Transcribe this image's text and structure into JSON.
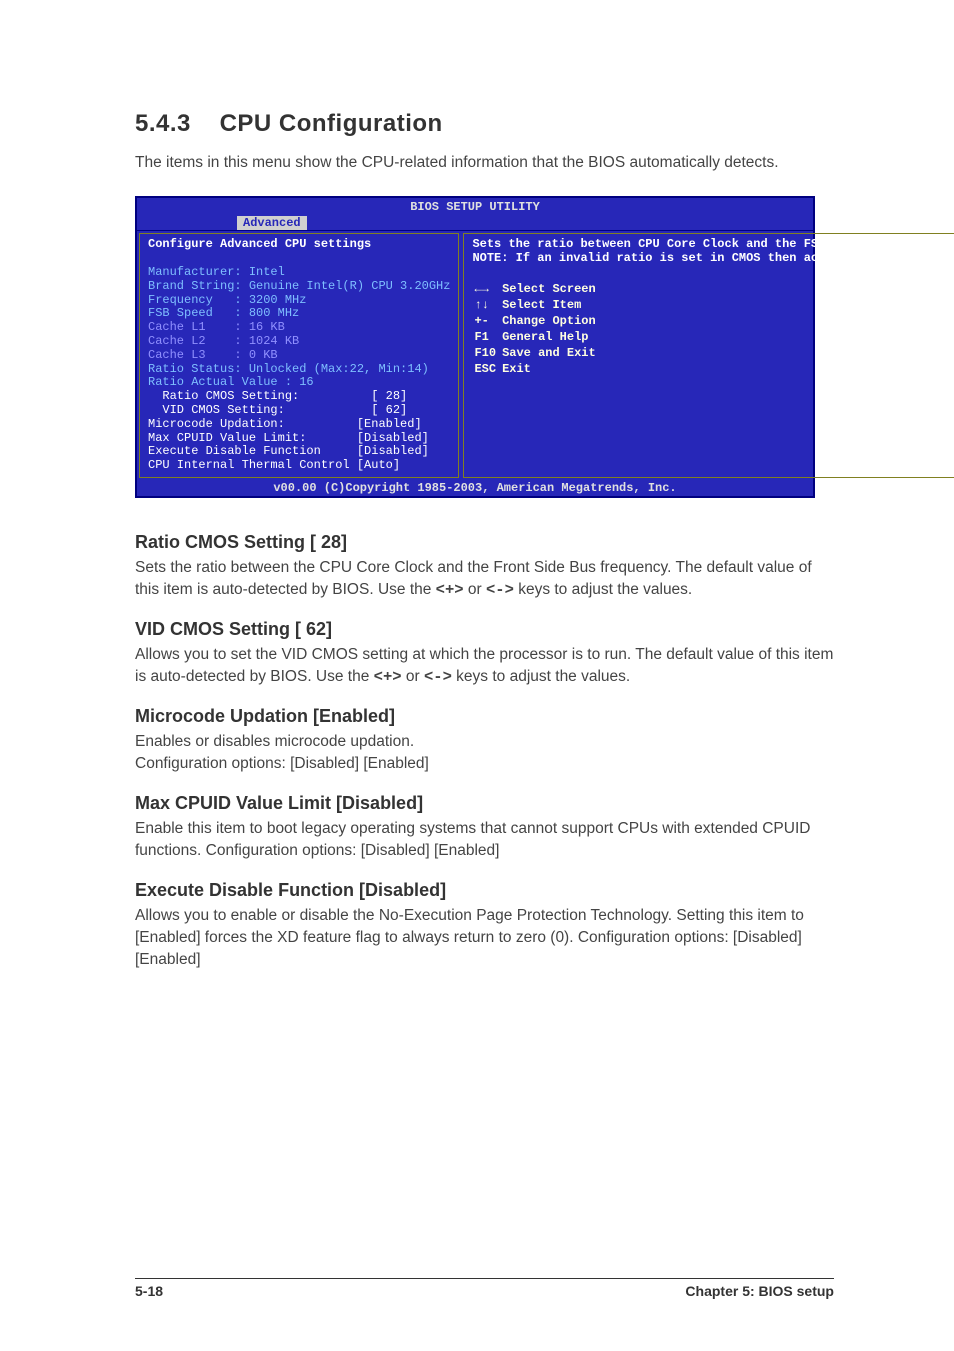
{
  "section_number": "5.4.3",
  "section_title": "CPU Configuration",
  "intro": "The items in this menu show the CPU-related information that the BIOS automatically detects.",
  "bios": {
    "title": "BIOS SETUP UTILITY",
    "tab": "Advanced",
    "left_heading": "Configure Advanced CPU settings",
    "info_lines": {
      "manufacturer": "Manufacturer: Intel",
      "brand": "Brand String: Genuine Intel(R) CPU 3.20GHz",
      "frequency": "Frequency   : 3200 MHz",
      "fsb": "FSB Speed   : 800 MHz",
      "l1": "Cache L1    : 16 KB",
      "l2": "Cache L2    : 1024 KB",
      "l3": "Cache L3    : 0 KB",
      "ratio_status": "Ratio Status: Unlocked (Max:22, Min:14)",
      "ratio_actual": "Ratio Actual Value : 16"
    },
    "settings": [
      {
        "label": "  Ratio CMOS Setting:",
        "value": "[ 28]"
      },
      {
        "label": "  VID CMOS Setting:",
        "value": "[ 62]"
      },
      {
        "label": "Microcode Updation:",
        "value": "[Enabled]"
      },
      {
        "label": "Max CPUID Value Limit:",
        "value": "[Disabled]"
      },
      {
        "label": "Execute Disable Function",
        "value": "[Disabled]"
      },
      {
        "label": "CPU Internal Thermal Control",
        "value": "[Auto]"
      }
    ],
    "help_text": "Sets the ratio between CPU Core Clock and the FSB Frequency.\nNOTE: If an invalid ratio is set in CMOS then actual and setpoint values may differ.",
    "nav": [
      {
        "key": "←→",
        "label": "Select Screen"
      },
      {
        "key": "↑↓",
        "label": "Select Item"
      },
      {
        "key": "+-",
        "label": "Change Option"
      },
      {
        "key": "F1",
        "label": "General Help"
      },
      {
        "key": "F10",
        "label": "Save and Exit"
      },
      {
        "key": "ESC",
        "label": "Exit"
      }
    ],
    "footer": "v00.00 (C)Copyright 1985-2003, American Megatrends, Inc."
  },
  "options": {
    "ratio_cmos": {
      "heading": "Ratio CMOS Setting [ 28]",
      "body_pre": "Sets the ratio between the CPU Core Clock and the Front Side Bus frequency. The default value of this item is auto-detected by BIOS. Use the ",
      "key1": "<+>",
      "mid": " or ",
      "key2": "<->",
      "body_post": " keys to adjust the values."
    },
    "vid_cmos": {
      "heading": "VID CMOS Setting [ 62]",
      "body_pre": "Allows you to set the VID CMOS setting at which the processor is to run. The default value of this item is auto-detected by BIOS. Use the ",
      "key1": "<+>",
      "mid": " or ",
      "key2": "<->",
      "body_post": " keys to adjust the values."
    },
    "microcode": {
      "heading": "Microcode Updation [Enabled]",
      "body": "Enables or disables microcode updation.\nConfiguration options: [Disabled] [Enabled]"
    },
    "max_cpuid": {
      "heading": "Max CPUID Value Limit [Disabled]",
      "body": "Enable this item to boot legacy operating systems that cannot support CPUs with extended CPUID functions. Configuration options: [Disabled] [Enabled]"
    },
    "xd": {
      "heading": "Execute Disable Function [Disabled]",
      "body": "Allows you to enable or disable the No-Execution Page Protection Technology. Setting this item to [Enabled] forces the XD feature flag to always return to zero (0). Configuration options: [Disabled] [Enabled]"
    }
  },
  "footer": {
    "left": "5-18",
    "right": "Chapter 5: BIOS setup"
  }
}
